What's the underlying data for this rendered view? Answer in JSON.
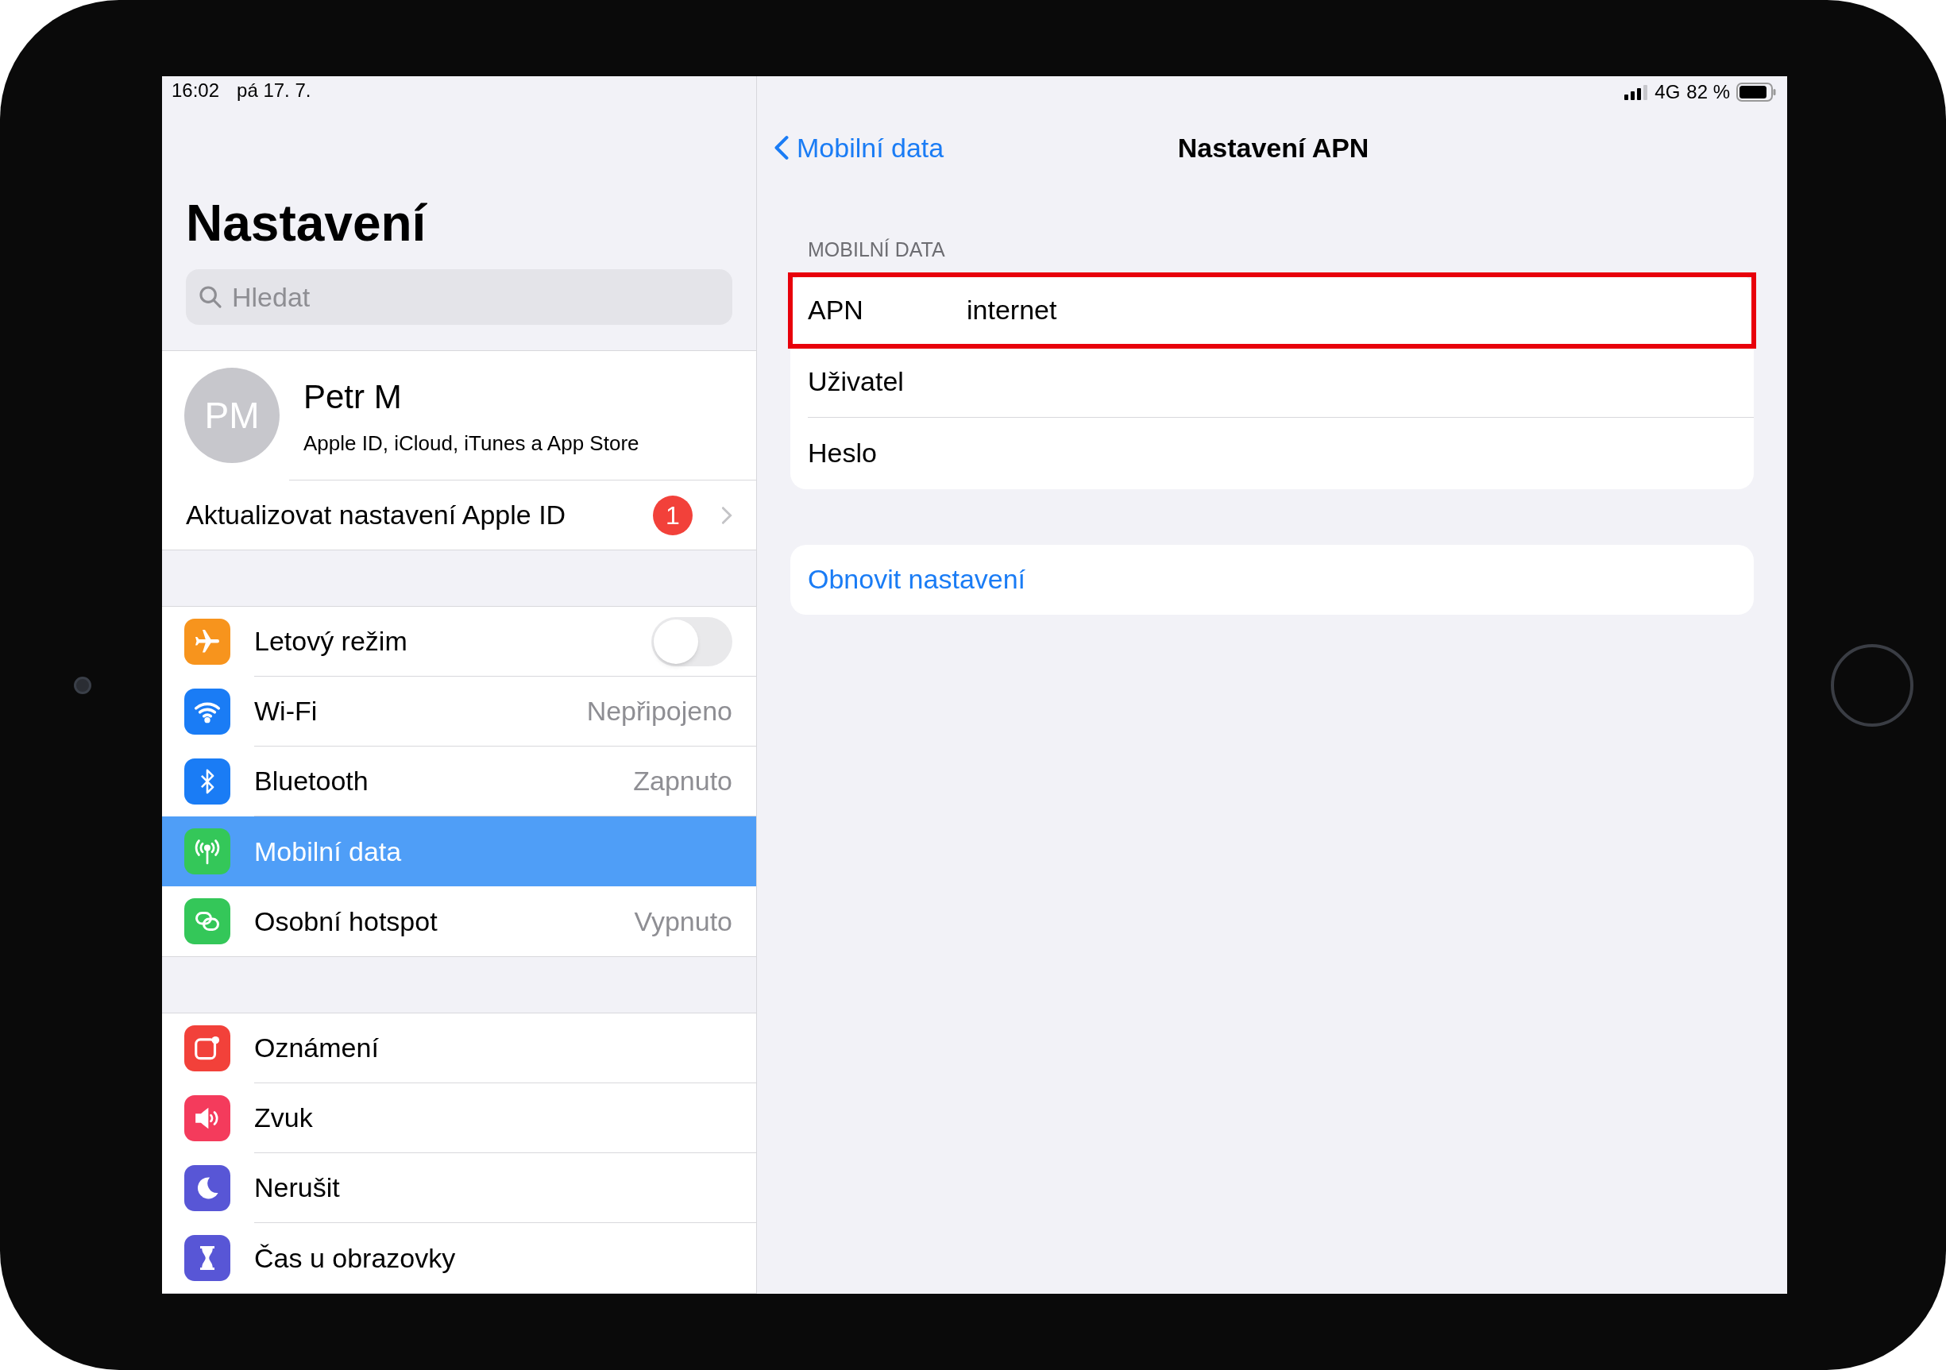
{
  "status_bar": {
    "time": "16:02",
    "date": "pá 17. 7.",
    "network": "4G",
    "battery": "82 %"
  },
  "sidebar": {
    "title": "Nastavení",
    "search": {
      "placeholder": "Hledat"
    },
    "profile": {
      "initials": "PM",
      "name": "Petr M",
      "subtitle": "Apple ID, iCloud, iTunes a App Store"
    },
    "notice": {
      "label": "Aktualizovat nastavení Apple ID",
      "badge": "1"
    },
    "groups": [
      [
        {
          "label": "Letový režim",
          "kind": "toggle",
          "on": false,
          "color": "#f7941d",
          "selected": false
        },
        {
          "label": "Wi-Fi",
          "kind": "value",
          "value": "Nepřipojeno",
          "color": "#1a7cf5",
          "selected": false
        },
        {
          "label": "Bluetooth",
          "kind": "value",
          "value": "Zapnuto",
          "color": "#1a7cf5",
          "selected": false
        },
        {
          "label": "Mobilní data",
          "kind": "link",
          "color": "#34c759",
          "selected": true
        },
        {
          "label": "Osobní hotspot",
          "kind": "value",
          "value": "Vypnuto",
          "color": "#34c759",
          "selected": false
        }
      ],
      [
        {
          "label": "Oznámení",
          "kind": "link",
          "color": "#f2413a",
          "selected": false
        },
        {
          "label": "Zvuk",
          "kind": "link",
          "color": "#f43b5c",
          "selected": false
        },
        {
          "label": "Nerušit",
          "kind": "link",
          "color": "#5856d6",
          "selected": false
        },
        {
          "label": "Čas u obrazovky",
          "kind": "link",
          "color": "#5856d6",
          "selected": false
        }
      ]
    ]
  },
  "detail": {
    "back": "Mobilní data",
    "title": "Nastavení APN",
    "section": "MOBILNÍ DATA",
    "fields": [
      {
        "label": "APN",
        "value": "internet",
        "highlighted": true
      },
      {
        "label": "Uživatel",
        "highlighted": false
      },
      {
        "label": "Heslo",
        "highlighted": false
      }
    ],
    "reset": "Obnovit nastavení"
  }
}
